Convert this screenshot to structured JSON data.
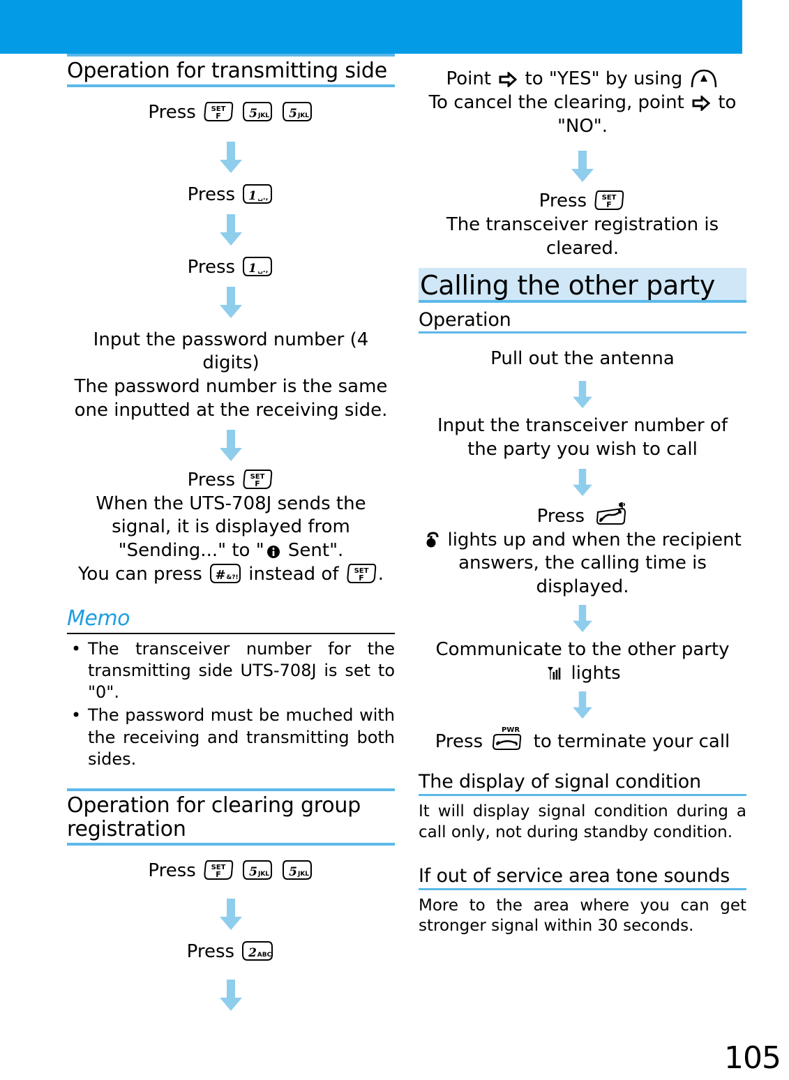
{
  "colors": {
    "banner": "#039be5",
    "rule": "#5bb8e8",
    "band": "#cfe7f7",
    "memo_heading": "#1e9ee0",
    "arrow": "#8fcdec"
  },
  "page": {
    "number": "105"
  },
  "left_column": {
    "heading_transmitting": "Operation for transmitting side",
    "steps": [
      {
        "text_before": "Press",
        "keys": [
          "set-f-key",
          "5-jkl-key",
          "5-jkl-key"
        ]
      },
      {
        "text_before": "Press",
        "keys": [
          "1-key"
        ]
      },
      {
        "text_before": "Press",
        "keys": [
          "1-key"
        ]
      }
    ],
    "password_step": {
      "line1": "Input the password number (4 digits)",
      "line2": "The password number is the same",
      "line3": "one inputted at the receiving side."
    },
    "press_set_step": {
      "press_label": "Press",
      "key": "set-f-key",
      "line1": "When the UTS-708J sends the",
      "line2": "signal, it is displayed from",
      "line3_a": "\"Sending...\" to \"",
      "line3_icon": "sent-indicator-icon",
      "line3_b": " Sent\".",
      "line4_a": "You can press",
      "line4_key": "hash-key",
      "line4_b": "instead of",
      "line4_key2": "set-f-key",
      "line4_c": "."
    },
    "memo": {
      "title": "Memo",
      "items": [
        "The transceiver number for the transmitting side UTS-708J is set to \"0\".",
        "The password must be muched with the receiving and transmitting both sides."
      ]
    },
    "heading_clearing": "Operation for clearing group registration",
    "clearing_steps": [
      {
        "text_before": "Press",
        "keys": [
          "set-f-key",
          "5-jkl-key",
          "5-jkl-key"
        ]
      },
      {
        "text_before": "Press",
        "keys": [
          "2-abc-key"
        ]
      }
    ]
  },
  "right_column": {
    "point_step": {
      "line1_a": "Point",
      "line1_icon": "cursor-arrow-icon",
      "line1_b": "to \"YES\" by using",
      "line1_key": "up-arrow-key",
      "line2_a": "To cancel the clearing, point",
      "line2_icon": "cursor-arrow-icon",
      "line2_b": "to",
      "line3": "\"NO\"."
    },
    "press_set_step": {
      "press_label": "Press",
      "key": "set-f-key",
      "line1": "The transceiver registration is",
      "line2": "cleared."
    },
    "heading_calling": "Calling the other party",
    "heading_operation": "Operation",
    "calling_steps": {
      "step1": "Pull out the antenna",
      "step2_line1": "Input the transceiver number of",
      "step2_line2": "the party you wish to call",
      "step3_press": "Press",
      "step3_key": "talk-key",
      "step3_icon": "handset-indicator-icon",
      "step3_line1": " lights up and when the recipient",
      "step3_line2": "answers, the calling time is",
      "step3_line3": "displayed.",
      "step4_line1": "Communicate to the other party",
      "step4_icon": "signal-bars-icon",
      "step4_line2": " lights",
      "step5_a": "Press",
      "step5_key": "pwr-end-key",
      "step5_b": "to terminate your call"
    },
    "signal_section": {
      "heading": "The display of signal condition",
      "body": "It will display signal condition during a call only, not during standby condition."
    },
    "out_of_service_section": {
      "heading": "If out of service area tone sounds",
      "body": "More to the area where you can get stronger signal within 30 seconds."
    }
  }
}
